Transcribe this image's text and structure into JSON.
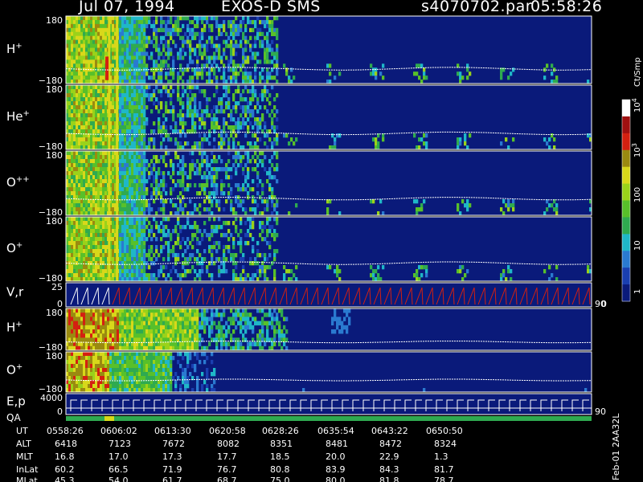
{
  "header": {
    "date": "Jul 07, 1994",
    "instrument": "EXOS-D SMS",
    "file": "s4070702.par",
    "time": "05:58:26"
  },
  "colors": {
    "background": "#000000",
    "plot_bg": "#0a1a7a",
    "scale": [
      "#0a1a7a",
      "#1a3fb0",
      "#2a7ad0",
      "#1fb7c8",
      "#2faa50",
      "#58c02a",
      "#9ad21a",
      "#d8d81a",
      "#9a8a10",
      "#d42010",
      "#a01010",
      "#ffffff"
    ]
  },
  "chart_data": {
    "type": "heatmap",
    "panels": [
      {
        "label": "H",
        "sup": "+",
        "ytop": "180",
        "ybot": "−180"
      },
      {
        "label": "He",
        "sup": "+",
        "ytop": "180",
        "ybot": "−180"
      },
      {
        "label": "O",
        "sup": "++",
        "ytop": "180",
        "ybot": "−180"
      },
      {
        "label": "O",
        "sup": "+",
        "ytop": "180",
        "ybot": "−180"
      },
      {
        "label": "V,r",
        "sup": "",
        "ytop": "25",
        "ybot": "0",
        "right": "90"
      },
      {
        "label": "H",
        "sup": "+",
        "ytop": "180",
        "ybot": "−180"
      },
      {
        "label": "O",
        "sup": "+",
        "ytop": "180",
        "ybot": "−180"
      },
      {
        "label": "E,p",
        "sup": "",
        "ytop": "4000",
        "ybot": "0",
        "right": "90"
      }
    ],
    "qa_label": "QA",
    "colorbar": {
      "unit": "Ct/Smp",
      "ticks": [
        {
          "label": "10",
          "sup": "4"
        },
        {
          "label": "10",
          "sup": "3"
        },
        {
          "label": "100",
          "sup": ""
        },
        {
          "label": "10",
          "sup": ""
        },
        {
          "label": "1",
          "sup": ""
        }
      ],
      "zero": "0"
    },
    "ephemeris": {
      "rows": [
        "UT",
        "ALT",
        "MLT",
        "InLat",
        "MLat"
      ],
      "columns": [
        {
          "UT": "0558:26",
          "ALT": "6418",
          "MLT": "16.8",
          "InLat": "60.2",
          "MLat": "45.3"
        },
        {
          "UT": "0606:02",
          "ALT": "7123",
          "MLT": "17.0",
          "InLat": "66.5",
          "MLat": "54.0"
        },
        {
          "UT": "0613:30",
          "ALT": "7672",
          "MLT": "17.3",
          "InLat": "71.9",
          "MLat": "61.7"
        },
        {
          "UT": "0620:58",
          "ALT": "8082",
          "MLT": "17.7",
          "InLat": "76.7",
          "MLat": "68.7"
        },
        {
          "UT": "0628:26",
          "ALT": "8351",
          "MLT": "18.5",
          "InLat": "80.8",
          "MLat": "75.0"
        },
        {
          "UT": "0635:54",
          "ALT": "8481",
          "MLT": "20.0",
          "InLat": "83.9",
          "MLat": "80.0"
        },
        {
          "UT": "0643:22",
          "ALT": "8472",
          "MLT": "22.9",
          "InLat": "84.3",
          "MLat": "81.8"
        },
        {
          "UT": "0650:50",
          "ALT": "8324",
          "MLT": "1.3",
          "InLat": "81.7",
          "MLat": "78.7"
        }
      ]
    },
    "footer_tag": "Feb-01 2AA32L"
  }
}
